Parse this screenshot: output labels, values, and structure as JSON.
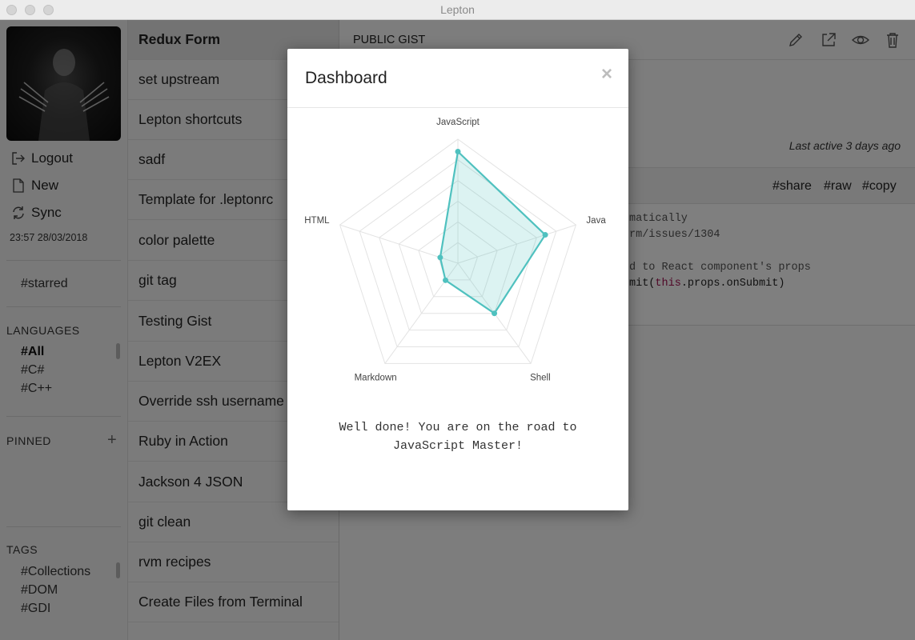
{
  "window": {
    "title": "Lepton"
  },
  "sidebar": {
    "actions": [
      {
        "label": "Logout",
        "icon": "logout-icon"
      },
      {
        "label": "New",
        "icon": "new-file-icon"
      },
      {
        "label": "Sync",
        "icon": "sync-icon"
      }
    ],
    "timestamp": "23:57 28/03/2018",
    "starred": "#starred",
    "languages_heading": "LANGUAGES",
    "languages": [
      "#All",
      "#C#",
      "#C++"
    ],
    "pinned_heading": "PINNED",
    "tags_heading": "TAGS",
    "tags": [
      "#Collections",
      "#DOM",
      "#GDI"
    ]
  },
  "gist_list": [
    "Redux Form",
    "set upstream",
    "Lepton shortcuts",
    "sadf",
    "Template for .leptonrc",
    "color palette",
    "git tag",
    "Testing Gist",
    "Lepton V2EX",
    "Override ssh username",
    "Ruby in Action",
    "Jackson 4 JSON",
    "git clean",
    "rvm recipes",
    "Create Files from Terminal"
  ],
  "detail": {
    "kind": "PUBLIC GIST",
    "last_active": "Last active 3 days ago",
    "file_actions": [
      "#share",
      "#raw",
      "#copy"
    ],
    "code": {
      "line1": "matically",
      "line2": "rm/issues/1304",
      "line3": "d to React component's props",
      "line4_pre": "mit(",
      "line4_kw": "this",
      "line4_post": ".props.onSubmit)"
    }
  },
  "dashboard": {
    "title": "Dashboard",
    "close": "×",
    "message": "Well done! You are on the road to JavaScript Master!",
    "accent": "#4fc1bf",
    "fill": "rgba(79,193,191,0.2)"
  },
  "chart_data": {
    "type": "radar",
    "categories": [
      "JavaScript",
      "Java",
      "Shell",
      "Markdown",
      "HTML"
    ],
    "values": [
      0.9,
      0.74,
      0.5,
      0.17,
      0.15
    ],
    "rlim": [
      0,
      1
    ],
    "grid_levels": 6
  }
}
